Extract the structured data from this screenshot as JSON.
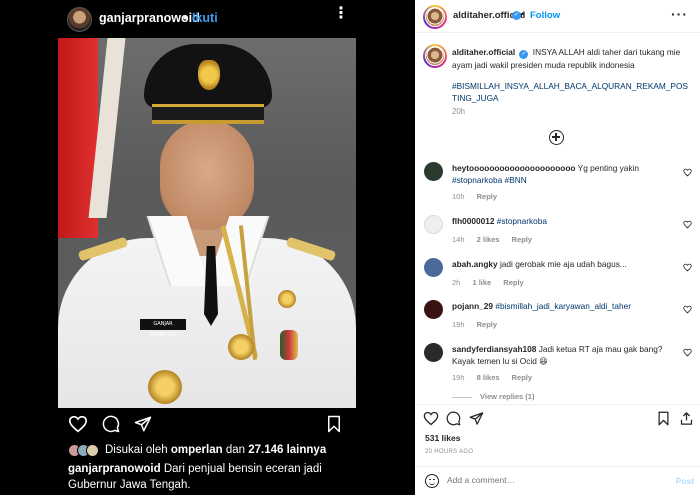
{
  "left": {
    "username": "ganjarpranowoid",
    "dot": "•",
    "follow_label": "Ikuti",
    "more": "⋮",
    "nameplate": "GANJAR PRANOWO",
    "liked_prefix": "Disukai oleh",
    "liked_user": "omperlan",
    "liked_middle": "dan",
    "liked_count": "27.146 lainnya",
    "caption_user": "ganjarpranowoid",
    "caption_text": "Dari penjual bensin eceran jadi Gubernur Jawa Tengah.",
    "icons": [
      "heart-icon",
      "comment-icon",
      "share-icon",
      "bookmark-icon"
    ]
  },
  "header": {
    "username": "alditaher.official",
    "dot": "•",
    "follow_label": "Follow",
    "more": "···"
  },
  "caption": {
    "username": "alditaher.official",
    "text": "INSYA ALLAH aldi taher dari tukang mie ayam jadi wakil presiden muda republik indonesia",
    "hashtags": "#BISMILLAH_INSYA_ALLAH_BACA_ALQURAN_REKAM_POSTING_JUGA",
    "time": "20h"
  },
  "comments": [
    {
      "username": "heytooooooooooooooooooooo",
      "text": "Yg penting yakin",
      "tags": "#stopnarkoba #BNN",
      "time": "10h",
      "likes": "",
      "reply": "Reply",
      "avatar_color": "#2b3a2f"
    },
    {
      "username": "flh0000012",
      "text": "",
      "tags": "#stopnarkoba",
      "time": "14h",
      "likes": "2 likes",
      "reply": "Reply",
      "avatar_color": "#e8e8e8"
    },
    {
      "username": "abah.angky",
      "text": "jadi gerobak mie aja udah bagus...",
      "tags": "",
      "time": "2h",
      "likes": "1 like",
      "reply": "Reply",
      "avatar_color": "#4a6a9a"
    },
    {
      "username": "pojann_29",
      "text": "",
      "tags": "#bismillah_jadi_karyawan_aldi_taher",
      "time": "19h",
      "likes": "",
      "reply": "Reply",
      "avatar_color": "#3a1212"
    },
    {
      "username": "sandyferdiansyah108",
      "text": "Jadi ketua RT aja mau gak bang? Kayak temen lu si Ocid 😆",
      "tags": "",
      "time": "19h",
      "likes": "8 likes",
      "reply": "Reply",
      "avatar_color": "#2a2a2a"
    }
  ],
  "view_replies": "View replies (1)",
  "likes": "531 likes",
  "date": "20 HOURS AGO",
  "add_comment_placeholder": "Add a comment…",
  "post_label": "Post",
  "colors": {
    "link": "#0095f6",
    "hashtag": "#00376b",
    "muted": "#8e8e8e",
    "left_bg": "#000000",
    "follow_left": "#3d9cf0"
  }
}
